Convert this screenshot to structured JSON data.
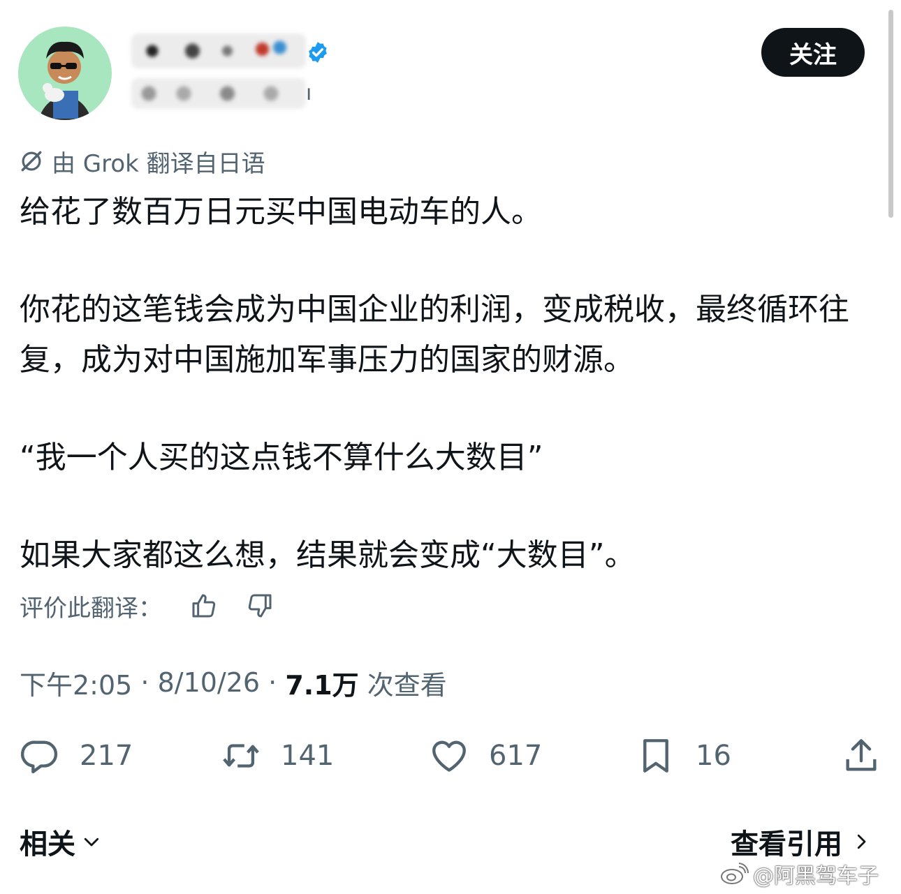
{
  "header": {
    "follow_label": "关注",
    "handle_tail": "ı"
  },
  "translation": {
    "source_label": "由 Grok 翻译自日语",
    "rate_label": "评价此翻译："
  },
  "tweet": {
    "paragraphs": [
      "给花了数百万日元买中国电动车的人。",
      "你花的这笔钱会成为中国企业的利润，变成税收，最终循环往复，成为对中国施加军事压力的国家的财源。",
      "“我一个人买的这点钱不算什么大数目”",
      "如果大家都这么想，结果就会变成“大数目”。"
    ]
  },
  "meta": {
    "time": "下午2:05",
    "sep1": " · ",
    "date": "8/10/26",
    "sep2": " · ",
    "views_count": "7.1万",
    "views_label": " 次查看"
  },
  "actions": {
    "replies": "217",
    "reposts": "141",
    "likes": "617",
    "bookmarks": "16"
  },
  "footer": {
    "related_label": "相关",
    "quotes_label": "查看引用"
  },
  "watermark": "@阿黑驾车子",
  "colors": {
    "text": "#0f1419",
    "secondary": "#536471",
    "verified": "#1d9bf0",
    "button_bg": "#0f1419"
  }
}
